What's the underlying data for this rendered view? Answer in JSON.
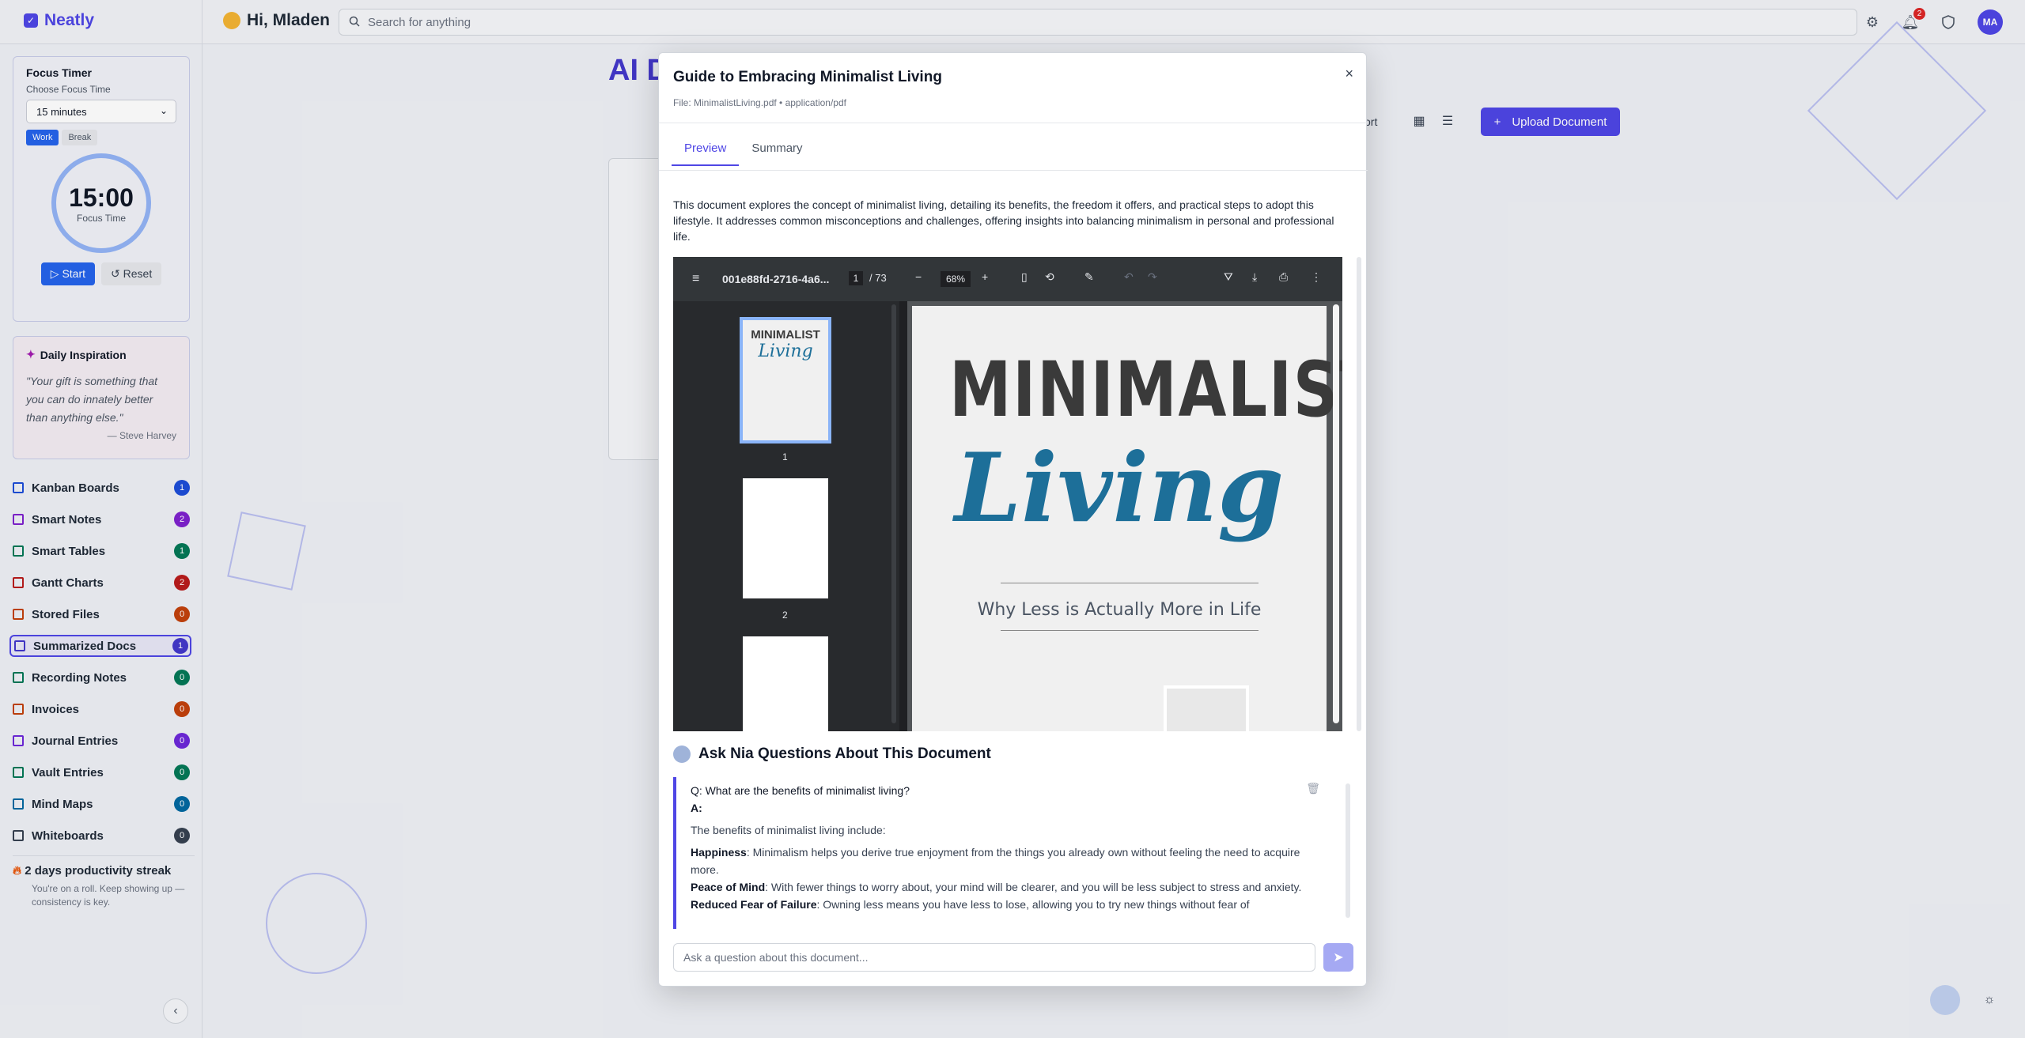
{
  "app": {
    "name": "Neatly",
    "greeting": "Hi, Mladen",
    "search_placeholder": "Search for anything",
    "notifications_count": "2",
    "avatar_initials": "MA"
  },
  "focus": {
    "title": "Focus Timer",
    "choose_label": "Choose Focus Time",
    "selected": "15 minutes",
    "mode_work": "Work",
    "mode_break": "Break",
    "time": "15:00",
    "time_label": "Focus Time",
    "start": "Start",
    "reset": "Reset"
  },
  "inspiration": {
    "title": "Daily Inspiration",
    "quote": "\"Your gift is something that you can do innately better than anything else.\"",
    "author": "— Steve Harvey"
  },
  "nav": [
    {
      "label": "Kanban Boards",
      "count": "1",
      "color": "#1d4ed8"
    },
    {
      "label": "Smart Notes",
      "count": "2",
      "color": "#7e22ce"
    },
    {
      "label": "Smart Tables",
      "count": "1",
      "color": "#047857"
    },
    {
      "label": "Gantt Charts",
      "count": "2",
      "color": "#b91c1c"
    },
    {
      "label": "Stored Files",
      "count": "0",
      "color": "#c2410c"
    },
    {
      "label": "Summarized Docs",
      "count": "1",
      "color": "#4338ca"
    },
    {
      "label": "Recording Notes",
      "count": "0",
      "color": "#047857"
    },
    {
      "label": "Invoices",
      "count": "0",
      "color": "#c2410c"
    },
    {
      "label": "Journal Entries",
      "count": "0",
      "color": "#6d28d9"
    },
    {
      "label": "Vault Entries",
      "count": "0",
      "color": "#047857"
    },
    {
      "label": "Mind Maps",
      "count": "0",
      "color": "#0369a1"
    },
    {
      "label": "Whiteboards",
      "count": "0",
      "color": "#374151"
    }
  ],
  "streak": {
    "title": "2 days productivity streak",
    "text": "You're on a roll. Keep showing up — consistency is key."
  },
  "page": {
    "title": "AI D",
    "sort": "ort",
    "upload": "Upload Document"
  },
  "modal": {
    "title": "Guide to Embracing Minimalist Living",
    "file": "File: MinimalistLiving.pdf • application/pdf",
    "tab_preview": "Preview",
    "tab_summary": "Summary",
    "description": "This document explores the concept of minimalist living, detailing its benefits, the freedom it offers, and practical steps to adopt this lifestyle. It addresses common misconceptions and challenges, offering insights into balancing minimalism in personal and professional life.",
    "viewer": {
      "filename": "001e88fd-2716-4a6...",
      "page": "1",
      "total": "/ 73",
      "zoom": "68%",
      "thumb1": "1",
      "thumb2": "2",
      "cover_title": "MINIMALIST",
      "cover_script": "Living",
      "cover_sub": "Why Less is Actually More in Life"
    },
    "ask_title": "Ask Nia Questions About This Document",
    "question": "Q: What are the benefits of minimalist living?",
    "answer_label": "A:",
    "answer_intro": "The benefits of minimalist living include:",
    "b1_title": "Happiness",
    "b1_text": ": Minimalism helps you derive true enjoyment from the things you already own without feeling the need to acquire more.",
    "b2_title": "Peace of Mind",
    "b2_text": ": With fewer things to worry about, your mind will be clearer, and you will be less subject to stress and anxiety.",
    "b3_title": "Reduced Fear of Failure",
    "b3_text": ": Owning less means you have less to lose, allowing you to try new things without fear of",
    "input_placeholder": "Ask a question about this document..."
  }
}
